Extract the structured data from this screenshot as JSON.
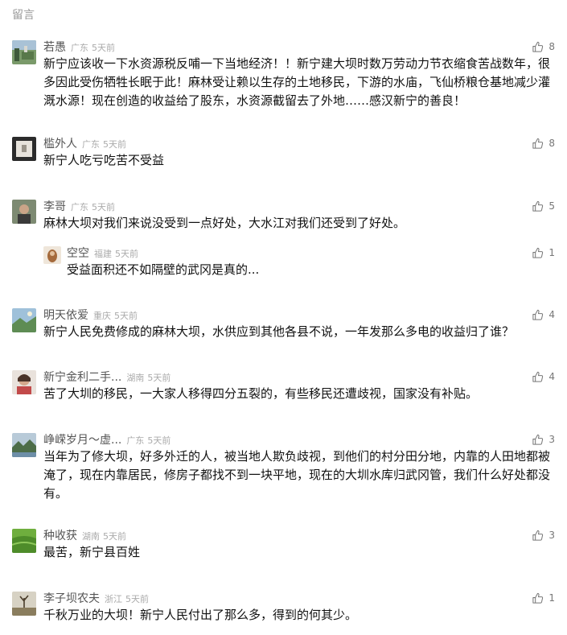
{
  "section_title": "留言",
  "comments": [
    {
      "user": "若愚",
      "location": "广东",
      "time": "5天前",
      "likes": "8",
      "text": "新宁应该收一下水资源税反哺一下当地经济！！新宁建大坝时数万劳动力节衣缩食苦战数年，很多因此受伤牺牲长眠于此！麻林受让赖以生存的土地移民，下游的水庙，飞仙桥粮仓基地减少灌溉水源！现在创造的收益给了股东，水资源截留去了外地……感汉新宁的善良！"
    },
    {
      "user": "槛外人",
      "location": "广东",
      "time": "5天前",
      "likes": "8",
      "text": "新宁人吃亏吃苦不受益"
    },
    {
      "user": "李哥",
      "location": "广东",
      "time": "5天前",
      "likes": "5",
      "text": "麻林大坝对我们来说没受到一点好处，大水江对我们还受到了好处。"
    },
    {
      "user": "空空",
      "location": "福建",
      "time": "5天前",
      "likes": "1",
      "text": "受益面积还不如隔壁的武冈是真的..."
    },
    {
      "user": "明天依爱",
      "location": "重庆",
      "time": "5天前",
      "likes": "4",
      "text": "新宁人民免费修成的麻林大坝，水供应到其他各县不说，一年发那么多电的收益归了谁？"
    },
    {
      "user": "新宁金利二手...",
      "location": "湖南",
      "time": "5天前",
      "likes": "4",
      "text": "苦了大圳的移民，一大家人移得四分五裂的，有些移民还遭歧视，国家没有补贴。"
    },
    {
      "user": "峥嵘岁月～虚...",
      "location": "广东",
      "time": "5天前",
      "likes": "3",
      "text": "当年为了修大坝，好多外迁的人，被当地人欺负歧视，到他们的村分田分地，内靠的人田地都被淹了，现在内靠居民，修房子都找不到一块平地，现在的大圳水库归武冈管，我们什么好处都没有。"
    },
    {
      "user": "种收获",
      "location": "湖南",
      "time": "5天前",
      "likes": "3",
      "text": "最苦，新宁县百姓"
    },
    {
      "user": "李子坝农夫",
      "location": "浙江",
      "time": "5天前",
      "likes": "1",
      "text": "千秋万业的大坝！新宁人民付出了那么多，得到的何其少。"
    }
  ],
  "icons": {
    "like": "thumbs-up-icon"
  },
  "colors": {
    "meta": "#aaaaaa",
    "name": "#555555",
    "text": "#111111",
    "header": "#999999"
  }
}
